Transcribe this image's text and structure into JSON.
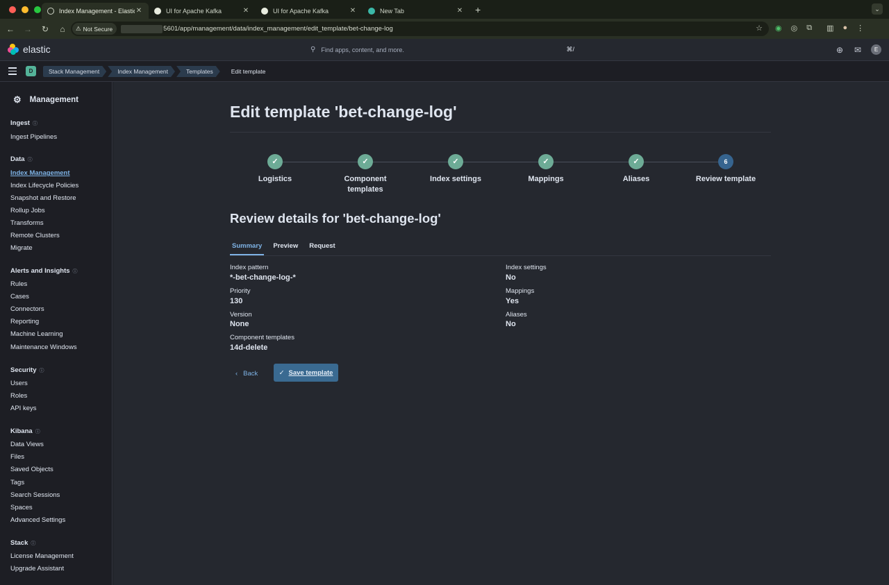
{
  "browser": {
    "tabs": [
      {
        "title": "Index Management - Elastic",
        "active": true
      },
      {
        "title": "UI for Apache Kafka",
        "active": false
      },
      {
        "title": "UI for Apache Kafka",
        "active": false
      },
      {
        "title": "New Tab",
        "active": false
      }
    ],
    "security_label": "Not Secure",
    "url": "5601/app/management/data/index_management/edit_template/bet-change-log"
  },
  "header": {
    "brand": "elastic",
    "search_placeholder": "Find apps, content, and more.",
    "search_shortcut": "⌘/",
    "avatar_initial": "E"
  },
  "breadcrumbs": {
    "space_initial": "D",
    "items": [
      "Stack Management",
      "Index Management",
      "Templates",
      "Edit template"
    ]
  },
  "sidebar": {
    "title": "Management",
    "groups": {
      "ingest": {
        "label": "Ingest",
        "items": [
          "Ingest Pipelines"
        ]
      },
      "data": {
        "label": "Data",
        "items": [
          "Index Management",
          "Index Lifecycle Policies",
          "Snapshot and Restore",
          "Rollup Jobs",
          "Transforms",
          "Remote Clusters",
          "Migrate"
        ]
      },
      "alerts": {
        "label": "Alerts and Insights",
        "items": [
          "Rules",
          "Cases",
          "Connectors",
          "Reporting",
          "Machine Learning",
          "Maintenance Windows"
        ]
      },
      "security": {
        "label": "Security",
        "items": [
          "Users",
          "Roles",
          "API keys"
        ]
      },
      "kibana": {
        "label": "Kibana",
        "items": [
          "Data Views",
          "Files",
          "Saved Objects",
          "Tags",
          "Search Sessions",
          "Spaces",
          "Advanced Settings"
        ]
      },
      "stack": {
        "label": "Stack",
        "items": [
          "License Management",
          "Upgrade Assistant"
        ]
      }
    }
  },
  "page": {
    "title": "Edit template 'bet-change-log'",
    "steps": [
      {
        "label": "Logistics",
        "status": "complete"
      },
      {
        "label": "Component templates",
        "status": "complete"
      },
      {
        "label": "Index settings",
        "status": "complete"
      },
      {
        "label": "Mappings",
        "status": "complete"
      },
      {
        "label": "Aliases",
        "status": "complete"
      },
      {
        "label": "Review template",
        "status": "current",
        "number": "6"
      }
    ],
    "review_title": "Review details for 'bet-change-log'",
    "tabs": [
      "Summary",
      "Preview",
      "Request"
    ],
    "summary": {
      "index_pattern_label": "Index pattern",
      "index_pattern_value": "*-bet-change-log-*",
      "priority_label": "Priority",
      "priority_value": "130",
      "version_label": "Version",
      "version_value": "None",
      "component_templates_label": "Component templates",
      "component_templates_value": "14d-delete",
      "index_settings_label": "Index settings",
      "index_settings_value": "No",
      "mappings_label": "Mappings",
      "mappings_value": "Yes",
      "aliases_label": "Aliases",
      "aliases_value": "No"
    },
    "back_label": "Back",
    "save_label": "Save template"
  }
}
